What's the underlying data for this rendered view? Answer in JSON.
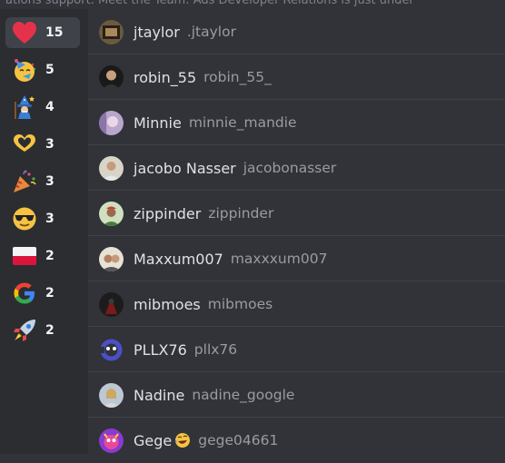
{
  "top_text": "ations support. Meet the Team: Ads Developer Relations is just under",
  "reactions": [
    {
      "icon": "red-heart-icon",
      "count": "15",
      "selected": true
    },
    {
      "icon": "party-face-icon",
      "count": "5"
    },
    {
      "icon": "mage-icon",
      "count": "4"
    },
    {
      "icon": "heart-hands-icon",
      "count": "3"
    },
    {
      "icon": "party-popper-icon",
      "count": "3"
    },
    {
      "icon": "cool-face-icon",
      "count": "3"
    },
    {
      "icon": "poland-flag-icon",
      "count": "2"
    },
    {
      "icon": "google-logo-icon",
      "count": "2"
    },
    {
      "icon": "rocket-icon",
      "count": "2"
    }
  ],
  "users": [
    {
      "name": "jtaylor",
      "username": ".jtaylor"
    },
    {
      "name": "robin_55",
      "username": "robin_55_"
    },
    {
      "name": "Minnie",
      "username": "minnie_mandie"
    },
    {
      "name": "jacobo Nasser",
      "username": "jacobonasser"
    },
    {
      "name": "zippinder",
      "username": "zippinder"
    },
    {
      "name": "Maxxum007",
      "username": "maxxxum007"
    },
    {
      "name": "mibmoes",
      "username": "mibmoes"
    },
    {
      "name": "PLLX76",
      "username": "pllx76"
    },
    {
      "name": "Nadine",
      "username": "nadine_google"
    },
    {
      "name": "Gege",
      "username": "gege04661",
      "name_emoji": "rofl-face-icon"
    }
  ]
}
